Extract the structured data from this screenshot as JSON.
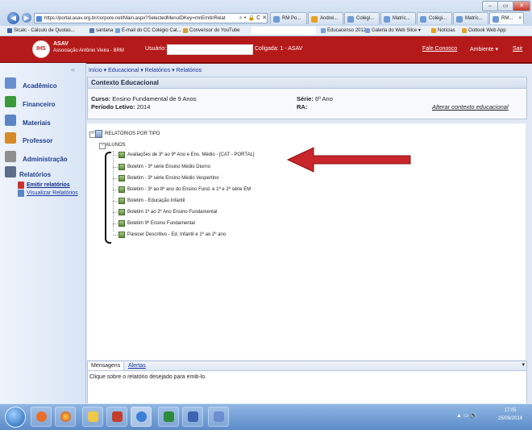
{
  "browser": {
    "address": "https://portal.asav.org.br/corpore.net/Main.aspx?SelectedMenuIDKey=mnEmitirRelat",
    "address_icons": "⌕ ▾ 🔒 C ✕",
    "tabs": [
      "RM Po...",
      "Andrei...",
      "Colégi...",
      "Matríc...",
      "Colégi...",
      "Matríc...",
      "RM..."
    ],
    "active_tab_close": "×",
    "favorites": [
      "Sicalc - Cálculo de Quotas...",
      "santana",
      "E-mail do CC Colégio Cat...",
      "Convensor do YouTube",
      "Educacenso 2012",
      "Galeria do Web Slice ▾",
      "Notícias",
      "Outlook Web App"
    ],
    "window_controls": [
      "–",
      "▭",
      "✕"
    ]
  },
  "header": {
    "title_line1": "ASAV",
    "title_line2": "Associação Antônio Vieira - BRM",
    "user_label": "Usuário:",
    "coligada": "Coligada: 1 - ASAV",
    "links": [
      "Fale Conosco",
      "Ambiente ▾",
      "Sair"
    ]
  },
  "sidebar": {
    "collapse": "«",
    "items": [
      {
        "label": "Acadêmico",
        "color": "#6a8fd0"
      },
      {
        "label": "Financeiro",
        "color": "#3d9a3d"
      },
      {
        "label": "Materiais",
        "color": "#5d84c5"
      },
      {
        "label": "Professor",
        "color": "#d48b2a"
      },
      {
        "label": "Administração",
        "color": "#8f8f8f"
      },
      {
        "label": "Relatórios",
        "color": "#5c6e8a"
      }
    ],
    "subitems": [
      "Emitir relatórios",
      "Visualizar Relatórios"
    ]
  },
  "breadcrumb": "Início ▾  Educacional ▾  Relatórios ▾  Relatórios",
  "context": {
    "title": "Contexto Educacional",
    "curso_label": "Curso:",
    "curso_value": "Ensino Fundamental de 9 Anos",
    "periodo_label": "Período Letivo:",
    "periodo_value": "2014",
    "serie_label": "Série:",
    "serie_value": "6º Ano",
    "ra_label": "RA:",
    "change_link": "Alterar contexto educacional"
  },
  "tree": {
    "root": "RELATÓRIOS POR TIPO",
    "group": "ALUNOS",
    "reports": [
      "Avaliações de 3º ao 9º Ano e Ens. Médio - [CAT - PORTAL]",
      "Boletim - 3ª série Ensino Médio Diurno",
      "Boletim - 3ª série Ensino Médio Vespertino",
      "Boletim - 3º ao 8º ano do Ensino Fund. e 1ª e 2ª série EM",
      "Boletim - Educação Infantil",
      "Boletim 1º ao 2º Ano Ensino Fundamental",
      "Boletim 9º Ensino Fundamental",
      "Parecer Descritivo - Ed. Infantil e 1º ao 2º ano"
    ]
  },
  "messages": {
    "tabs": [
      "Mensagens",
      "Alertas"
    ],
    "text": "Clique sobre o relatório desejado para emiti-lo.",
    "dropdown": "▾"
  },
  "taskbar": {
    "tray": "▲  ▭  🔊",
    "time": "17:05",
    "date": "25/09/2014"
  },
  "colors": {
    "header_red": "#b51a1a",
    "arrow_red": "#c8262b"
  }
}
